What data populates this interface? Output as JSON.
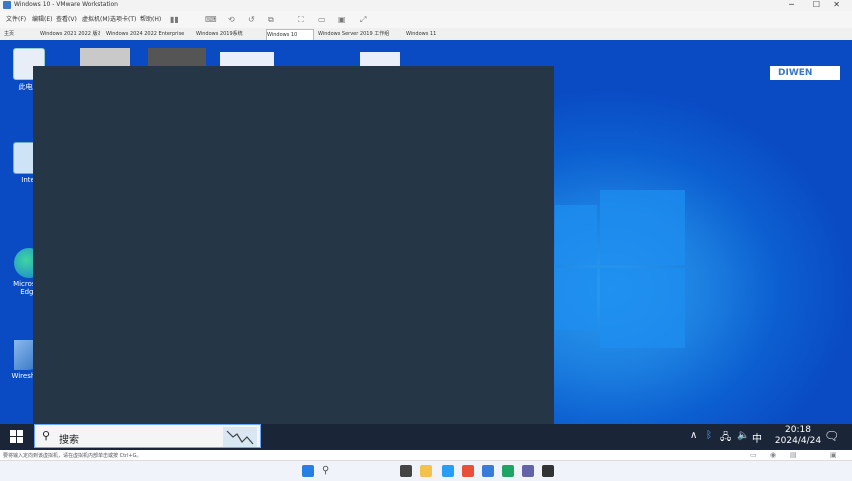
{
  "host": {
    "title": "Windows 10 - VMware Workstation",
    "menu": [
      "文件(F)",
      "编辑(E)",
      "查看(V)",
      "虚拟机(M)",
      "选项卡(T)",
      "帮助(H)"
    ],
    "tabs": [
      "主页",
      "Windows 2021 2022 版本...",
      "Windows 2024 2022 Enterprise",
      "Windows 2019系统",
      "Windows 10",
      "Windows Server 2019 工作组",
      "Windows 11"
    ],
    "status": "要将输入定向到该虚拟机，请在虚拟机内部单击或按 Ctrl+G。",
    "watermark": "DIWEN"
  },
  "desktop": {
    "icons": [
      {
        "label": "此电脑",
        "icon": "computer-icon"
      },
      {
        "label": "Intel",
        "icon": "app-icon"
      },
      {
        "label": "Microsoft Edge",
        "icon": "edge-icon"
      },
      {
        "label": "Wireshark",
        "icon": "wireshark-icon"
      }
    ]
  },
  "taskbar": {
    "search_placeholder": "搜索",
    "clock_time": "20:18",
    "clock_date": "2024/4/24",
    "ime": "中"
  },
  "colors": {
    "dialog": "#253746",
    "taskbar": "#1a2638",
    "desktop": "#0a4bc4"
  }
}
